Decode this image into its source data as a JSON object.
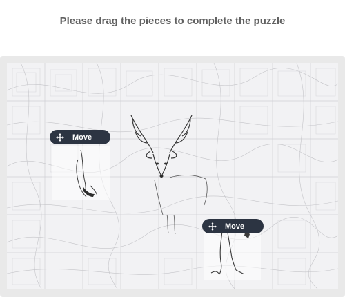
{
  "instruction": "Please drag the pieces to complete the puzzle",
  "pieces": [
    {
      "move_label": "Move",
      "icon": "move-arrows-icon"
    },
    {
      "move_label": "Move",
      "icon": "move-arrows-icon"
    }
  ],
  "colors": {
    "title": "#616161",
    "frame": "#e9e9e9",
    "board": "#f2f2f4",
    "move_button": "#2c3442",
    "move_text": "#ffffff"
  }
}
